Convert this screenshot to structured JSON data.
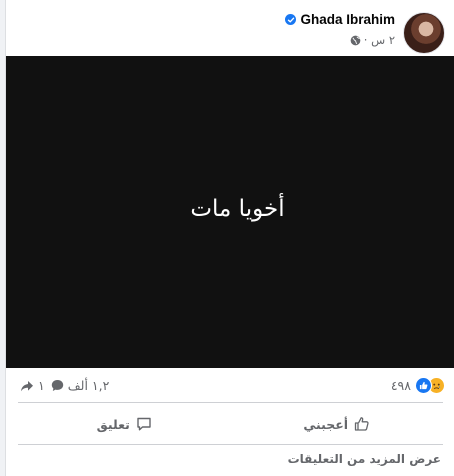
{
  "post": {
    "author": "Ghada Ibrahim",
    "time": "٢ س ·",
    "body_text": "أخويا مات"
  },
  "reactions": {
    "count": "٤٩٨",
    "types": [
      "like-icon",
      "sad-icon"
    ]
  },
  "stats": {
    "comments": "١,٢ ألف",
    "shares": "١"
  },
  "actions": {
    "like_label": "أعجبني",
    "comment_label": "تعليق"
  },
  "footer": {
    "more_comments": "عرض المزيد من التعليقات"
  },
  "colors": {
    "accent": "#1877f2",
    "sad": "#f7b125",
    "muted": "#65676b",
    "media_bg": "#111111"
  }
}
